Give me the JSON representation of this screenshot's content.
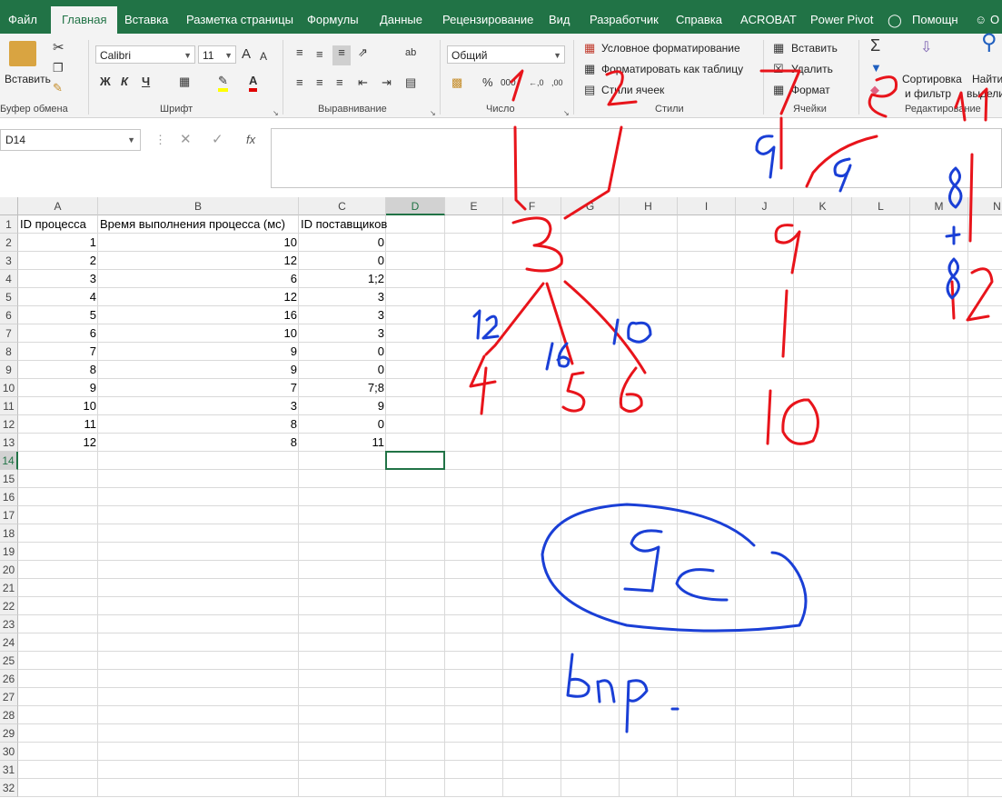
{
  "tabs": [
    "Файл",
    "Главная",
    "Вставка",
    "Разметка страницы",
    "Формулы",
    "Данные",
    "Рецензирование",
    "Вид",
    "Разработчик",
    "Справка",
    "ACROBAT",
    "Power Pivot",
    "Помощн",
    "О"
  ],
  "ribbon": {
    "clipboard": {
      "paste": "Вставить",
      "label": "Буфер обмена"
    },
    "font": {
      "name": "Calibri",
      "size": "11",
      "bold": "Ж",
      "italic": "К",
      "underline": "Ч",
      "label": "Шрифт"
    },
    "alignment": {
      "label": "Выравнивание"
    },
    "number": {
      "format": "Общий",
      "percent": "%",
      "thousands": "000",
      "label": "Число"
    },
    "styles": {
      "conditional": "Условное форматирование",
      "table": "Форматировать как таблицу",
      "cell_styles": "Стили ячеек",
      "label": "Стили"
    },
    "cells": {
      "insert": "Вставить",
      "delete": "Удалить",
      "format": "Формат",
      "label": "Ячейки"
    },
    "editing": {
      "sort_line1": "Сортировка",
      "sort_line2": "и фильтр",
      "find_line1": "Найти",
      "find_line2": "выдели",
      "label": "Редактирование"
    }
  },
  "formula_bar": {
    "name_box": "D14",
    "fx": "fx",
    "value": ""
  },
  "columns": [
    "A",
    "B",
    "C",
    "D",
    "E",
    "F",
    "G",
    "H",
    "I",
    "J",
    "K",
    "L",
    "M",
    "N"
  ],
  "rows": [
    "1",
    "2",
    "3",
    "4",
    "5",
    "6",
    "7",
    "8",
    "9",
    "10",
    "11",
    "12",
    "13",
    "14",
    "15",
    "16",
    "17",
    "18",
    "19",
    "20",
    "21",
    "22",
    "23",
    "24",
    "25",
    "26",
    "27",
    "28",
    "29",
    "30",
    "31",
    "32"
  ],
  "headers": [
    "ID процесса",
    "Время выполнения процесса (мс)",
    "ID поставщиков"
  ],
  "table": [
    [
      "1",
      "10",
      "0"
    ],
    [
      "2",
      "12",
      "0"
    ],
    [
      "3",
      "6",
      "1;2"
    ],
    [
      "4",
      "12",
      "3"
    ],
    [
      "5",
      "16",
      "3"
    ],
    [
      "6",
      "10",
      "3"
    ],
    [
      "7",
      "9",
      "0"
    ],
    [
      "8",
      "9",
      "0"
    ],
    [
      "9",
      "7",
      "7;8"
    ],
    [
      "10",
      "3",
      "9"
    ],
    [
      "11",
      "8",
      "0"
    ],
    [
      "12",
      "8",
      "11"
    ]
  ],
  "selected_cell": "D14",
  "colors": {
    "accent": "#217346",
    "red_ink": "#e8141b",
    "blue_ink": "#1a3fd6"
  }
}
